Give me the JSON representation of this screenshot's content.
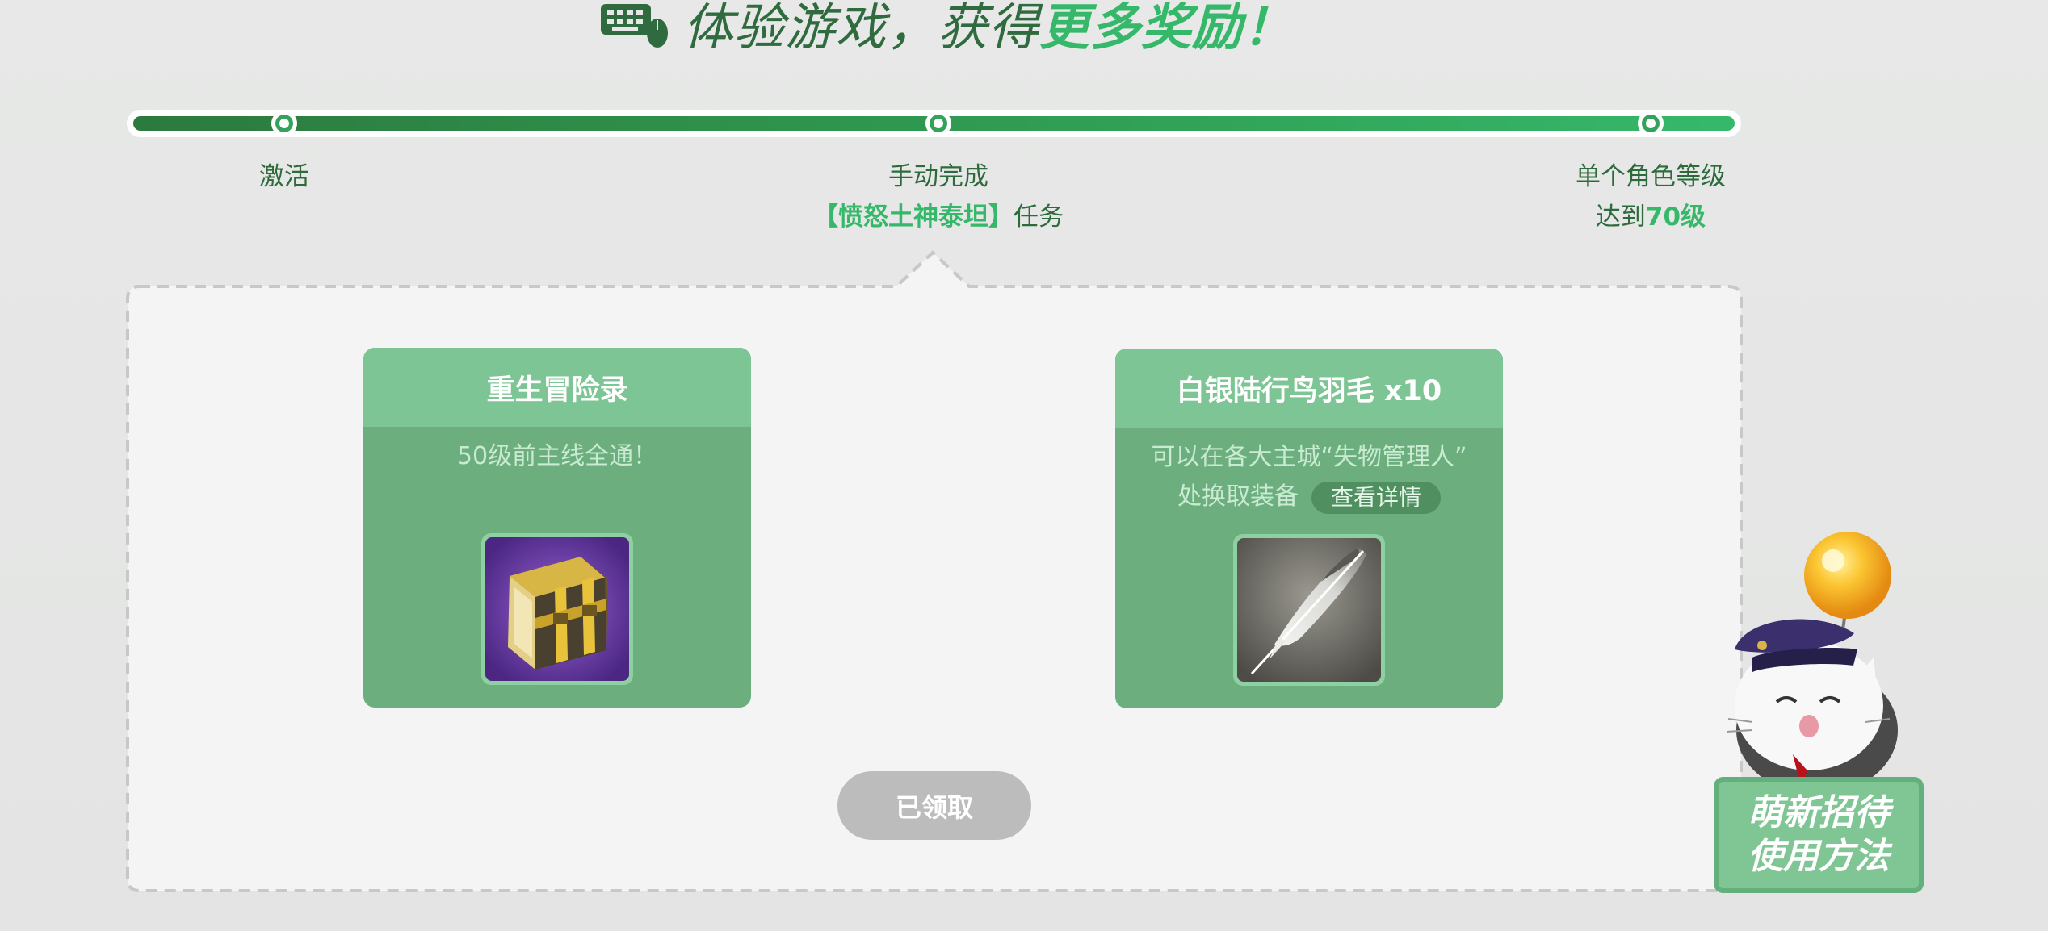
{
  "heading": {
    "text_plain": "体验游戏，获得",
    "text_highlight": "更多奖励！",
    "icon": "keyboard-mouse-icon"
  },
  "progress": {
    "milestones": [
      {
        "label": "激活"
      },
      {
        "label": "手动完成",
        "quest": "【愤怒土神泰坦】",
        "suffix": "任务"
      },
      {
        "label": "单个角色等级",
        "prefix": "达到",
        "level": "70级"
      }
    ]
  },
  "rewards": [
    {
      "title": "重生冒险录",
      "desc": "50级前主线全通！",
      "icon": "adventure-book-icon"
    },
    {
      "title": "白银陆行鸟羽毛 x10",
      "desc_line1": "可以在各大主城“失物管理人”",
      "desc_line2": "处换取装备",
      "detail_button": "查看详情",
      "icon": "silver-feather-icon"
    }
  ],
  "claim_button": "已领取",
  "guide": {
    "line1": "萌新招待",
    "line2": "使用方法"
  },
  "colors": {
    "accent": "#35b86a",
    "dark_green": "#2e6b3c",
    "card": "#6cae7e",
    "card_header": "#7dc595",
    "claimed": "#bcbcbc"
  }
}
